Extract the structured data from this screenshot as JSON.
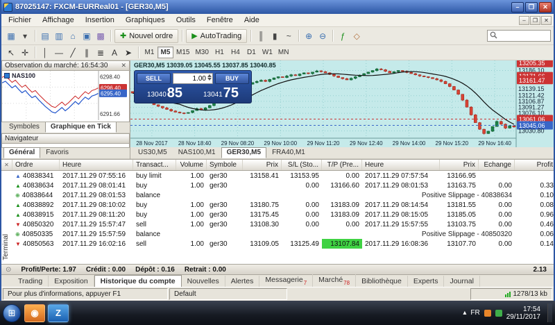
{
  "window": {
    "title": "87025147: FXCM-EURReal01 - [GER30,M5]"
  },
  "titlebar_controls": [
    {
      "name": "minimize-button",
      "glyph": "–"
    },
    {
      "name": "maximize-button",
      "glyph": "❐"
    },
    {
      "name": "close-button",
      "glyph": "✕"
    }
  ],
  "mdi_controls": [
    {
      "name": "mdi-minimize-button",
      "glyph": "–"
    },
    {
      "name": "mdi-restore-button",
      "glyph": "❐"
    },
    {
      "name": "mdi-close-button",
      "glyph": "✕"
    }
  ],
  "menu": {
    "items": [
      "Fichier",
      "Affichage",
      "Insertion",
      "Graphiques",
      "Outils",
      "Fenêtre",
      "Aide"
    ]
  },
  "toolbar": {
    "items1": [
      {
        "type": "icon",
        "base": "new-chart",
        "glyph": "▦",
        "color": "#3b6fb0"
      },
      {
        "type": "icon",
        "base": "profiles",
        "glyph": "▾",
        "color": "#444444"
      },
      {
        "type": "sep"
      },
      {
        "type": "icon",
        "base": "market-watch",
        "glyph": "▤",
        "color": "#3b6fb0"
      },
      {
        "type": "icon",
        "base": "data-window",
        "glyph": "▥",
        "color": "#3b6fb0"
      },
      {
        "type": "icon",
        "base": "navigator",
        "glyph": "⌂",
        "color": "#3b6fb0"
      },
      {
        "type": "icon",
        "base": "terminal",
        "glyph": "▣",
        "color": "#3b6fb0"
      },
      {
        "type": "icon",
        "base": "strategy-tester",
        "glyph": "▩",
        "color": "#7a5fb0"
      },
      {
        "type": "sep"
      },
      {
        "type": "button",
        "base": "new-order",
        "glyph": "✚",
        "color": "#1a8f1a",
        "label": "Nouvel ordre"
      },
      {
        "type": "sep"
      },
      {
        "type": "button",
        "base": "autotrading",
        "glyph": "▶",
        "color": "#1a8f1a",
        "label": "AutoTrading"
      },
      {
        "type": "sep"
      },
      {
        "type": "icon",
        "base": "bar-chart",
        "glyph": "║",
        "color": "#444444"
      },
      {
        "type": "icon",
        "base": "candlestick-chart",
        "glyph": "▮",
        "color": "#444444"
      },
      {
        "type": "icon",
        "base": "line-chart",
        "glyph": "~",
        "color": "#444444"
      },
      {
        "type": "sep"
      },
      {
        "type": "icon",
        "base": "zoom-in",
        "glyph": "⊕",
        "color": "#3b6fb0"
      },
      {
        "type": "icon",
        "base": "zoom-out",
        "glyph": "⊖",
        "color": "#3b6fb0"
      },
      {
        "type": "sep"
      },
      {
        "type": "icon",
        "base": "indicators",
        "glyph": "ƒ",
        "color": "#1a8f1a"
      },
      {
        "type": "icon",
        "base": "objects",
        "glyph": "◇",
        "color": "#b06f3b"
      }
    ],
    "items2": [
      {
        "type": "icon",
        "base": "cursor",
        "glyph": "↖",
        "color": "#333333"
      },
      {
        "type": "icon",
        "base": "crosshair",
        "glyph": "✛",
        "color": "#333333"
      },
      {
        "type": "sep"
      },
      {
        "type": "icon",
        "base": "vertical-line",
        "glyph": "│",
        "color": "#333333"
      },
      {
        "type": "icon",
        "base": "horizontal-line",
        "glyph": "―",
        "color": "#333333"
      },
      {
        "type": "icon",
        "base": "trendline",
        "glyph": "╱",
        "color": "#333333"
      },
      {
        "type": "icon",
        "base": "channel",
        "glyph": "∥",
        "color": "#333333"
      },
      {
        "type": "icon",
        "base": "fibonacci",
        "glyph": "≣",
        "color": "#333333"
      },
      {
        "type": "icon",
        "base": "text-tool",
        "glyph": "A",
        "color": "#333333"
      },
      {
        "type": "icon",
        "base": "arrows-tool",
        "glyph": "➤",
        "color": "#333333"
      },
      {
        "type": "sep"
      }
    ],
    "timeframes": [
      "M1",
      "M5",
      "M15",
      "M30",
      "H1",
      "H4",
      "D1",
      "W1",
      "MN"
    ],
    "active_timeframe": "M5"
  },
  "market_watch": {
    "title": "Observation du marché: 16:54:30",
    "close_glyph": "✕",
    "symbol": "NAS100",
    "tabs": [
      "Symboles",
      "Graphique en Tick"
    ],
    "active_tab": "Graphique en Tick",
    "range": [
      6290.5,
      6299.5
    ],
    "ticks": [
      6297.3,
      6297.6,
      6297.0,
      6296.4,
      6296.8,
      6296.1,
      6295.5,
      6295.9,
      6295.2,
      6294.6,
      6294.9,
      6294.2,
      6293.6,
      6293.0,
      6292.5,
      6292.0,
      6291.8,
      6292.3,
      6292.8,
      6292.2,
      6292.7,
      6293.3,
      6293.9,
      6293.4,
      6294.1,
      6294.7,
      6294.3,
      6294.9,
      6295.1,
      6295.4
    ],
    "ask_offset": 1.0,
    "scale_labels": [
      {
        "text": "6298.40",
        "v": 6298.4,
        "tag": "none"
      },
      {
        "text": "6296.40",
        "v": 6296.4,
        "tag": "red"
      },
      {
        "text": "6295.40",
        "v": 6295.4,
        "tag": "blue"
      },
      {
        "text": "6291.66",
        "v": 6291.66,
        "tag": "none"
      }
    ],
    "colors": {
      "bid": "#2255cc",
      "ask": "#cc2222",
      "grid": "#d8d8d8"
    }
  },
  "navigator": {
    "title": "Navigateur",
    "tabs": [
      "Général",
      "Favoris"
    ],
    "active_tab": "Général"
  },
  "chart": {
    "info": "GER30,M5  13039.05 13045.55 13037.85 13040.85",
    "tabs": [
      "US30,M5",
      "NAS100,M1",
      "GER30,M5",
      "FRA40,M1"
    ],
    "active_tab": "GER30,M5",
    "range": [
      13012,
      13212
    ],
    "closes": [
      13128,
      13122,
      13118,
      13112,
      13105,
      13098,
      13094,
      13090,
      13086,
      13082,
      13079,
      13077,
      13076,
      13078,
      13083,
      13088,
      13085,
      13090,
      13096,
      13102,
      13108,
      13114,
      13120,
      13127,
      13133,
      13140,
      13146,
      13151,
      13155,
      13158,
      13161,
      13158,
      13163,
      13167,
      13170,
      13168,
      13172,
      13175,
      13173,
      13177,
      13180,
      13178,
      13182,
      13185,
      13183,
      13180,
      13176,
      13172,
      13168,
      13165,
      13162,
      13166,
      13170,
      13174,
      13178,
      13182,
      13186,
      13190,
      13188,
      13184,
      13180,
      13183,
      13186,
      13184,
      13181,
      13178,
      13175,
      13172,
      13170,
      13168,
      13165,
      13162,
      13158,
      13152,
      13145,
      13136,
      13125,
      13110,
      13092,
      13072,
      13052,
      13035,
      13024,
      13030,
      13042,
      13055,
      13048,
      13038,
      13044,
      13041
    ],
    "price_labels": [
      {
        "text": "13205.35",
        "v": 13205.35,
        "tag": "red"
      },
      {
        "text": "13186.10",
        "v": 13186.1,
        "tag": "none"
      },
      {
        "text": "13171.66",
        "v": 13171.66,
        "tag": "red"
      },
      {
        "text": "13161.47",
        "v": 13161.47,
        "tag": "red"
      },
      {
        "text": "13139.15",
        "v": 13139.15,
        "tag": "none"
      },
      {
        "text": "13121.42",
        "v": 13121.42,
        "tag": "none"
      },
      {
        "text": "13106.87",
        "v": 13106.87,
        "tag": "none"
      },
      {
        "text": "13091.27",
        "v": 13091.27,
        "tag": "none"
      },
      {
        "text": "13076.10",
        "v": 13076.1,
        "tag": "none"
      },
      {
        "text": "13061.06",
        "v": 13061.06,
        "tag": "red"
      },
      {
        "text": "13045.06",
        "v": 13045.06,
        "tag": "blue"
      },
      {
        "text": "13030.80",
        "v": 13030.8,
        "tag": "none"
      }
    ],
    "lines": [
      {
        "v": 13061.06,
        "color": "#cc3333"
      },
      {
        "v": 13045.06,
        "color": "#3866c8"
      }
    ],
    "time_labels": [
      "28 Nov 2017",
      "28 Nov 18:40",
      "29 Nov 08:20",
      "29 Nov 10:00",
      "29 Nov 11:20",
      "29 Nov 12:40",
      "29 Nov 14:00",
      "29 Nov 15:20",
      "29 Nov 16:40"
    ],
    "colors": {
      "bg": "#c5eaea",
      "grid": "#93cfcf",
      "up": "#1d8348",
      "up_stroke": "#0e5a2e",
      "down": "#d84334",
      "down_stroke": "#9e2a1e",
      "ma": "#111111",
      "tag_red": "#cc3333",
      "tag_blue": "#3866c8"
    }
  },
  "trade_widget": {
    "sell_label": "SELL",
    "buy_label": "BUY",
    "volume": "1.00",
    "sell_small": "13040",
    "sell_big": "85",
    "buy_small": "13041",
    "buy_big": "75"
  },
  "terminal": {
    "side_label": "Terminal",
    "close_glyph": "✕",
    "columns": [
      "Ordre",
      "Heure",
      "Transact...",
      "Volume",
      "Symbole",
      "Prix",
      "S/L (Sto...",
      "T/P (Pre...",
      "Heure",
      "Prix",
      "Echange",
      "Profit"
    ],
    "row_icons": {
      "buy": {
        "glyph": "▲",
        "color": "#1a8f1a"
      },
      "sell": {
        "glyph": "▼",
        "color": "#cc2222"
      },
      "buy-limit": {
        "glyph": "▲",
        "color": "#3866c8"
      },
      "balance": {
        "glyph": "⊕",
        "color": "#1a8f1a"
      }
    },
    "rows": [
      {
        "icon": "buy-limit",
        "order": "40838341",
        "time": "2017.11.29 07:55:16",
        "type": "buy limit",
        "volume": "1.00",
        "symbol": "ger30",
        "price": "13158.41",
        "sl": "13153.95",
        "tp": "0.00",
        "time2": "2017.11.29 07:57:54",
        "price2": "13166.95",
        "swap": "",
        "profit": ""
      },
      {
        "icon": "buy",
        "order": "40838634",
        "time": "2017.11.29 08:01:41",
        "type": "buy",
        "volume": "1.00",
        "symbol": "ger30",
        "price": "",
        "sl": "0.00",
        "tp": "13166.60",
        "time2": "2017.11.29 08:01:53",
        "price2": "13163.75",
        "swap": "0.00",
        "profit": "0.33"
      },
      {
        "icon": "balance",
        "order": "40838644",
        "time": "2017.11.29 08:01:53",
        "type": "balance",
        "note": "Positive Slippage - 40838634",
        "profit": "0.10"
      },
      {
        "icon": "buy",
        "order": "40838892",
        "time": "2017.11.29 08:10:02",
        "type": "buy",
        "volume": "1.00",
        "symbol": "ger30",
        "price": "13180.75",
        "sl": "0.00",
        "tp": "13183.09",
        "time2": "2017.11.29 08:14:54",
        "price2": "13181.55",
        "swap": "0.00",
        "profit": "0.08"
      },
      {
        "icon": "buy",
        "order": "40838915",
        "time": "2017.11.29 08:11:20",
        "type": "buy",
        "volume": "1.00",
        "symbol": "ger30",
        "price": "13175.45",
        "sl": "0.00",
        "tp": "13183.09",
        "time2": "2017.11.29 08:15:05",
        "price2": "13185.05",
        "swap": "0.00",
        "profit": "0.96"
      },
      {
        "icon": "sell",
        "order": "40850320",
        "time": "2017.11.29 15:57:47",
        "type": "sell",
        "volume": "1.00",
        "symbol": "ger30",
        "price": "13108.30",
        "sl": "0.00",
        "tp": "0.00",
        "time2": "2017.11.29 15:57:55",
        "price2": "13103.75",
        "swap": "0.00",
        "profit": "0.46"
      },
      {
        "icon": "balance",
        "order": "40850335",
        "time": "2017.11.29 15:57:59",
        "type": "balance",
        "note": "Positive Slippage - 40850320",
        "profit": "0.06"
      },
      {
        "icon": "sell",
        "order": "40850563",
        "time": "2017.11.29 16:02:16",
        "type": "sell",
        "volume": "1.00",
        "symbol": "ger30",
        "price": "13109.05",
        "sl": "13125.49",
        "tp": "13107.84",
        "tp_highlight": true,
        "time2": "2017.11.29 16:08:36",
        "price2": "13107.70",
        "swap": "0.00",
        "profit": "0.14"
      }
    ],
    "summary": {
      "profit_label": "Profit/Perte:",
      "profit": "1.97",
      "credit_label": "Crédit :",
      "credit": "0.00",
      "deposit_label": "Dépôt :",
      "deposit": "0.16",
      "withdraw_label": "Retrait :",
      "withdraw": "0.00",
      "total": "2.13"
    },
    "tabs": [
      {
        "label": "Trading"
      },
      {
        "label": "Exposition"
      },
      {
        "label": "Historique du compte",
        "active": true
      },
      {
        "label": "Nouvelles"
      },
      {
        "label": "Alertes"
      },
      {
        "label": "Messagerie",
        "badge": "7"
      },
      {
        "label": "Marché",
        "badge": "78"
      },
      {
        "label": "Bibliothèque"
      },
      {
        "label": "Experts"
      },
      {
        "label": "Journal"
      }
    ]
  },
  "status_bar": {
    "help": "Pour plus d'informations, appuyer F1",
    "profile": "Default",
    "traffic": "1278/13 kb"
  },
  "taskbar": {
    "lang": "FR",
    "time": "17:54",
    "date": "29/11/2017",
    "start_glyph": "⊞",
    "hidden_icons_glyph": "▴",
    "apps": [
      {
        "name": "taskbar-app-orange",
        "glyph": "◉"
      },
      {
        "name": "taskbar-app-metatrader",
        "glyph": "Z"
      }
    ]
  }
}
